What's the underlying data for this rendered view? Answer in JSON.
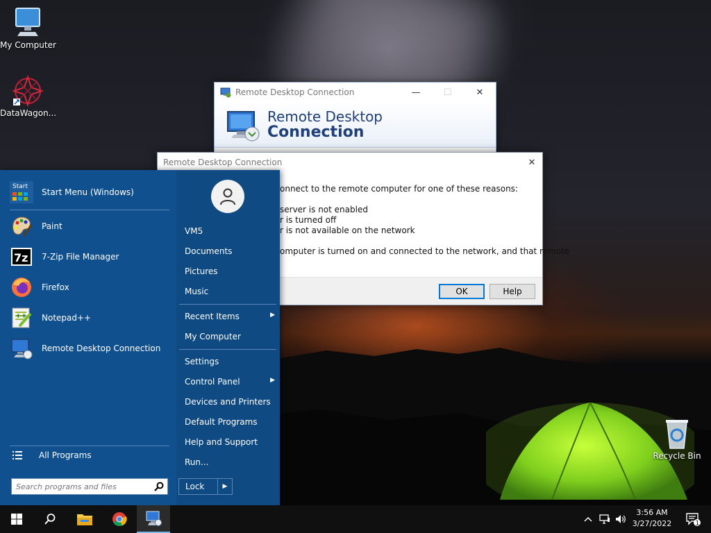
{
  "desktop": {
    "icons": [
      {
        "label": "My Computer",
        "icon": "monitor-icon"
      },
      {
        "label": "DataWagon...",
        "icon": "datawagon-logo-icon"
      },
      {
        "label": "Recycle Bin",
        "icon": "recycle-bin-icon"
      }
    ]
  },
  "rdc_window": {
    "title": "Remote Desktop Connection",
    "banner_line1": "Remote Desktop",
    "banner_line2": "Connection",
    "minimize_glyph": "—",
    "maximize_glyph": "☐",
    "close_glyph": "✕"
  },
  "error_dialog": {
    "title": "Remote Desktop Connection",
    "close_glyph": "✕",
    "lines": [
      "onnect to the remote computer for one of these reasons:",
      " server is not enabled",
      "r is turned off",
      "r is not available on the network",
      "omputer is turned on and connected to the network, and that remote"
    ],
    "ok_label": "OK",
    "help_label": "Help"
  },
  "start_menu": {
    "programs": [
      {
        "label": "Start Menu (Windows)",
        "icon": "start-menu-icon"
      },
      {
        "label": "Paint",
        "icon": "paint-palette-icon"
      },
      {
        "label": "7-Zip File Manager",
        "icon": "seven-zip-icon"
      },
      {
        "label": "Firefox",
        "icon": "firefox-icon"
      },
      {
        "label": "Notepad++",
        "icon": "notepad-plus-plus-icon"
      },
      {
        "label": "Remote Desktop Connection",
        "icon": "remote-desktop-icon"
      }
    ],
    "start_icon_text": "Start",
    "seven_zip_text": "7z",
    "notepad_text": "++",
    "all_programs": "All Programs",
    "search_placeholder": "Search programs and files",
    "places": [
      {
        "label": "VM5"
      },
      {
        "label": "Documents"
      },
      {
        "label": "Pictures"
      },
      {
        "label": "Music"
      },
      {
        "label": "Recent Items",
        "arrow": "▶"
      },
      {
        "label": "My Computer"
      },
      {
        "label": "Settings"
      },
      {
        "label": "Control Panel",
        "arrow": "▶"
      },
      {
        "label": "Devices and Printers"
      },
      {
        "label": "Default Programs"
      },
      {
        "label": "Help and Support"
      },
      {
        "label": "Run..."
      }
    ],
    "lock_label": "Lock",
    "lock_arrow": "▶"
  },
  "taskbar": {
    "time": "3:56 AM",
    "date": "3/27/2022",
    "notification_count": "1",
    "buttons": [
      "windows-start-icon",
      "search-icon",
      "file-explorer-icon",
      "chrome-icon",
      "remote-desktop-icon"
    ],
    "tray": [
      "chevron-up-icon",
      "network-icon",
      "volume-icon",
      "notification-icon"
    ]
  }
}
